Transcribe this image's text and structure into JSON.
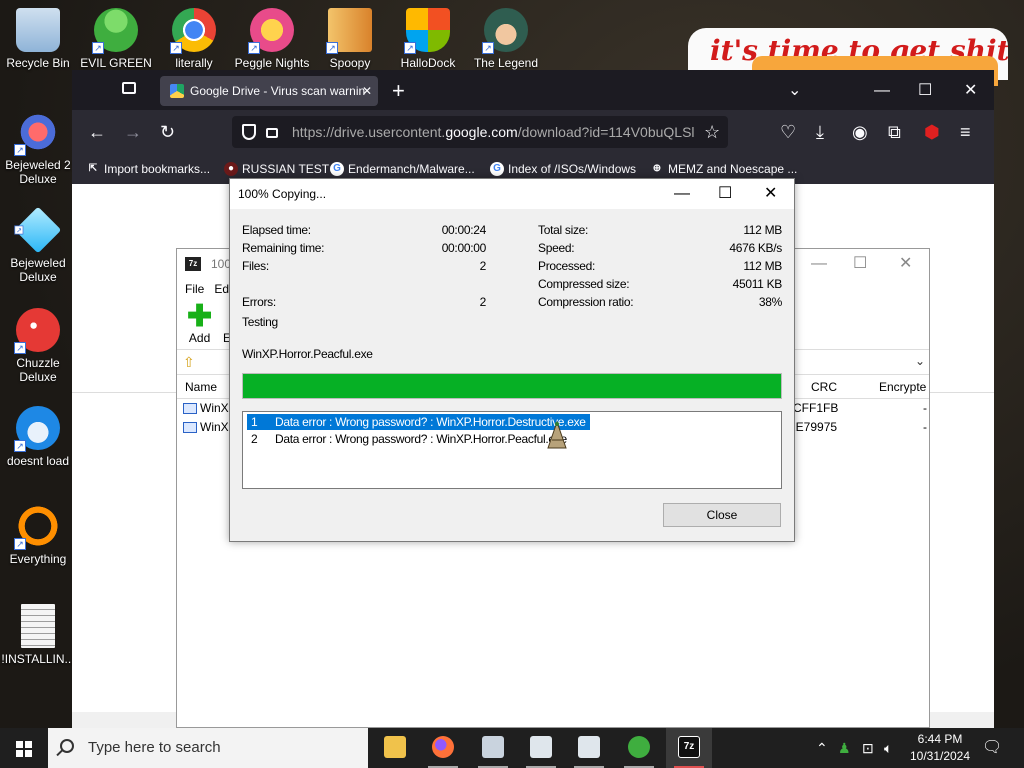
{
  "desktop": {
    "banner_text": "it's time to get shit",
    "icons": [
      {
        "label": "Recycle Bin",
        "color": "#8fb4d8"
      },
      {
        "label": "EVIL GREEN",
        "color": "#3fae3f"
      },
      {
        "label": "literally",
        "color": "#4285f4"
      },
      {
        "label": "Peggle Nights",
        "color": "#e84b8a"
      },
      {
        "label": "Spoopy",
        "color": "#d9822b"
      },
      {
        "label": "HalloDock",
        "color": "#f25022"
      },
      {
        "label": "The Legend",
        "color": "#3b7d6a"
      },
      {
        "label": "Bejeweled 2 Deluxe",
        "color": "#d32f2f"
      },
      {
        "label": "Bejeweled Deluxe",
        "color": "#29b6f6"
      },
      {
        "label": "Chuzzle Deluxe",
        "color": "#e53935"
      },
      {
        "label": "doesnt load",
        "color": "#1e88e5"
      },
      {
        "label": "Everything",
        "color": "#ff8f00"
      },
      {
        "label": "!INSTALLIN...",
        "color": "#f5f5f5"
      }
    ]
  },
  "browser": {
    "tab_title": "Google Drive - Virus scan warnin",
    "url_prefix": "https://drive.usercontent.",
    "url_domain": "google.com",
    "url_rest": "/download?id=114V0buQLSl",
    "bookmarks": [
      "Import bookmarks...",
      "RUSSIAN TEST",
      "Endermanch/Malware...",
      "Index of /ISOs/Windows",
      "MEMZ and Noescape ..."
    ]
  },
  "sevenzip": {
    "title": "100%",
    "menu": [
      "File",
      "Ed"
    ],
    "add_label": "Add",
    "extract_label": "E",
    "columns": {
      "name": "Name",
      "crc": "CRC",
      "encrypted": "Encrypte"
    },
    "rows": [
      {
        "name": "WinX",
        "crc": "CFF1FB",
        "enc": "-"
      },
      {
        "name": "WinX",
        "crc": "2E79975",
        "enc": "-"
      }
    ]
  },
  "dialog": {
    "title": "100% Copying...",
    "left": [
      {
        "label": "Elapsed time:",
        "value": "00:00:24"
      },
      {
        "label": "Remaining time:",
        "value": "00:00:00"
      },
      {
        "label": "Files:",
        "value": "2"
      },
      {
        "label": "Errors:",
        "value": "2"
      }
    ],
    "right": [
      {
        "label": "Total size:",
        "value": "112 MB"
      },
      {
        "label": "Speed:",
        "value": "4676 KB/s"
      },
      {
        "label": "Processed:",
        "value": "112 MB"
      },
      {
        "label": "Compressed size:",
        "value": "45011 KB"
      },
      {
        "label": "Compression ratio:",
        "value": "38%"
      }
    ],
    "status": "Testing",
    "current_file": "WinXP.Horror.Peacful.exe",
    "progress_percent": 100,
    "messages": [
      {
        "num": "1",
        "text": "Data error : Wrong password? : WinXP.Horror.Destructive.exe"
      },
      {
        "num": "2",
        "text": "Data error : Wrong password? : WinXP.Horror.Peacful.exe"
      }
    ],
    "close_label": "Close"
  },
  "taskbar": {
    "search_placeholder": "Type here to search",
    "time": "6:44 PM",
    "date": "10/31/2024"
  }
}
